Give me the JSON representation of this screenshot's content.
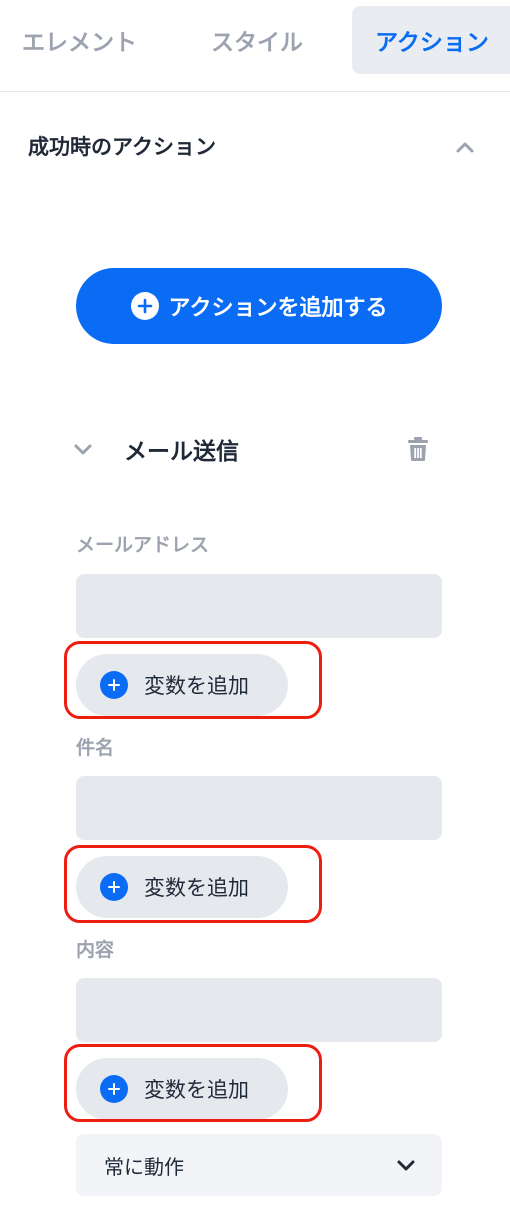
{
  "tabs": [
    {
      "label": "エレメント",
      "active": false
    },
    {
      "label": "スタイル",
      "active": false
    },
    {
      "label": "アクション",
      "active": true
    }
  ],
  "section": {
    "title": "成功時のアクション",
    "expanded": true
  },
  "add_action_button": {
    "label": "アクションを追加する",
    "icon": "plus-circle-icon"
  },
  "action": {
    "title": "メール送信",
    "expanded": true,
    "fields": [
      {
        "label": "メールアドレス",
        "value": "",
        "add_variable_label": "変数を追加"
      },
      {
        "label": "件名",
        "value": "",
        "add_variable_label": "変数を追加"
      },
      {
        "label": "内容",
        "value": "",
        "add_variable_label": "変数を追加"
      }
    ],
    "condition": {
      "selected": "常に動作"
    }
  },
  "colors": {
    "accent": "#0a6cf5",
    "highlight": "#ee1d12",
    "muted": "#9ca3af",
    "field_bg": "#e5e9ee"
  }
}
